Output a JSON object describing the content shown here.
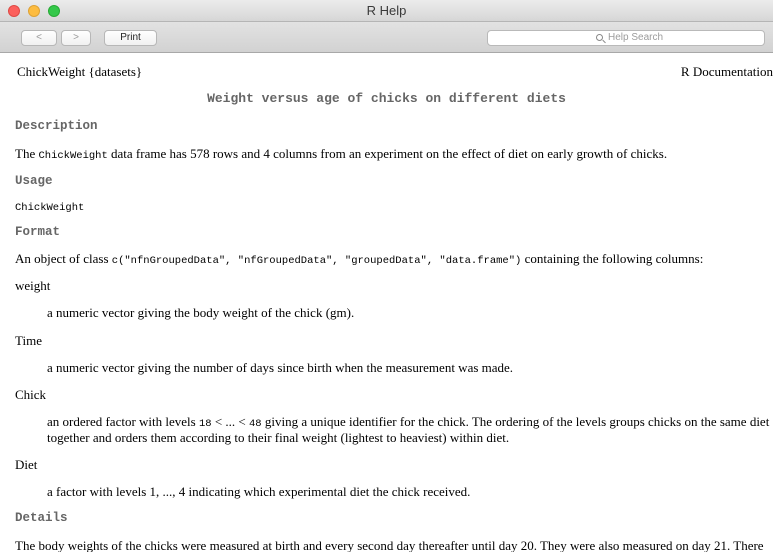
{
  "window": {
    "title": "R Help"
  },
  "toolbar": {
    "back_label": "<",
    "forward_label": ">",
    "print_label": "Print",
    "search_placeholder": "Help Search"
  },
  "header": {
    "left": "ChickWeight {datasets}",
    "right": "R Documentation"
  },
  "doc": {
    "title": "Weight versus age of chicks on different diets",
    "description_heading": "Description",
    "description": {
      "pre": "The ",
      "code": "ChickWeight",
      "post": " data frame has 578 rows and 4 columns from an experiment on the effect of diet on early growth of chicks."
    },
    "usage_heading": "Usage",
    "usage": "ChickWeight",
    "format_heading": "Format",
    "format": {
      "pre": "An object of class ",
      "code": "c(\"nfnGroupedData\", \"nfGroupedData\", \"groupedData\", \"data.frame\")",
      "post": " containing the following columns:"
    },
    "columns": [
      {
        "name": "weight",
        "desc": "a numeric vector giving the body weight of the chick (gm)."
      },
      {
        "name": "Time",
        "desc": "a numeric vector giving the number of days since birth when the measurement was made."
      },
      {
        "name": "Chick",
        "desc_pre": "an ordered factor with levels ",
        "code1": "18",
        "desc_mid": " < ... < ",
        "code2": "48",
        "desc_post": " giving a unique identifier for the chick. The ordering of the levels groups chicks on the same diet",
        "desc_line2": "together and orders them according to their final weight (lightest to heaviest) within diet."
      },
      {
        "name": "Diet",
        "desc": "a factor with levels 1, ..., 4 indicating which experimental diet the chick received."
      }
    ],
    "details_heading": "Details",
    "details": "The body weights of the chicks were measured at birth and every second day thereafter until day 20. They were also measured on day 21. There"
  }
}
